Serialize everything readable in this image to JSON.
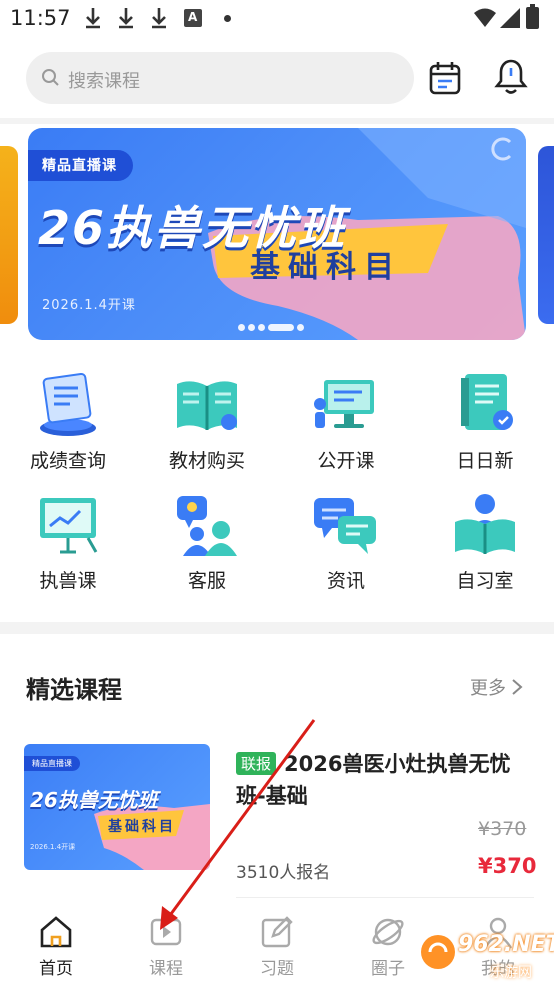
{
  "status_bar": {
    "time": "11:57",
    "account_glyph": "A"
  },
  "search": {
    "placeholder": "搜索课程"
  },
  "banner": {
    "tag": "精品直播课",
    "title": "26执兽无忧班",
    "subtitle": "基础科目",
    "date": "2026.1.4开课",
    "dot_count": 5,
    "active_dot": 3
  },
  "grid": [
    {
      "label": "成绩查询",
      "icon": "report-icon"
    },
    {
      "label": "教材购买",
      "icon": "book-icon"
    },
    {
      "label": "公开课",
      "icon": "monitor-icon"
    },
    {
      "label": "日日新",
      "icon": "notebook-icon"
    },
    {
      "label": "执兽课",
      "icon": "whiteboard-icon"
    },
    {
      "label": "客服",
      "icon": "support-icon"
    },
    {
      "label": "资讯",
      "icon": "chat-icon"
    },
    {
      "label": "自习室",
      "icon": "reading-icon"
    }
  ],
  "featured": {
    "title": "精选课程",
    "more": "更多",
    "course": {
      "badge": "联报",
      "name": "2026兽医小灶执兽无忧班-基础",
      "old_price": "¥370",
      "price": "¥370",
      "enrolled": "3510人报名",
      "thumb_tag": "精品直播课",
      "thumb_title": "26执兽无忧班",
      "thumb_subtitle": "基础科目",
      "thumb_date": "2026.1.4开课"
    }
  },
  "tabbar": [
    {
      "label": "首页",
      "icon": "home-icon",
      "active": true
    },
    {
      "label": "课程",
      "icon": "course-play-icon",
      "active": false
    },
    {
      "label": "习题",
      "icon": "edit-icon",
      "active": false
    },
    {
      "label": "圈子",
      "icon": "planet-icon",
      "active": false
    },
    {
      "label": "我的",
      "icon": "user-icon",
      "active": false
    }
  ],
  "watermark": {
    "brand": "962.NET",
    "sub": "乐游网"
  },
  "colors": {
    "accent": "#3a7cf5",
    "price": "#e8293b",
    "badge": "#2fb35a",
    "icon_teal": "#3cc9bd"
  }
}
